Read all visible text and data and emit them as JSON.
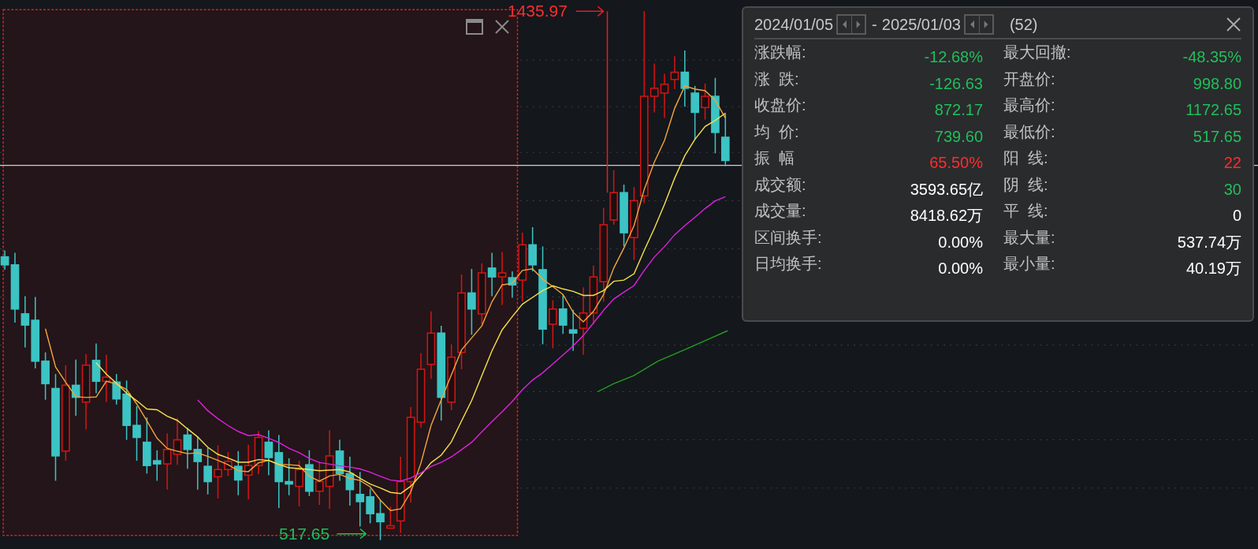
{
  "chart": {
    "high_label": "1435.97",
    "low_label": "517.65"
  },
  "stats_panel": {
    "start_date": "2024/01/05",
    "separator": "-",
    "end_date": "2025/01/03",
    "count": "(52)",
    "left_rows": [
      {
        "label": "涨跌幅:",
        "value": "-12.68%",
        "color": "#1fbf5a"
      },
      {
        "label": "涨  跌:",
        "value": "-126.63",
        "color": "#1fbf5a"
      },
      {
        "label": "收盘价:",
        "value": "872.17",
        "color": "#1fbf5a"
      },
      {
        "label": "均  价:",
        "value": "739.60",
        "color": "#1fbf5a"
      },
      {
        "label": "振  幅",
        "value": "65.50%",
        "color": "#ff2d2d"
      },
      {
        "label": "成交额:",
        "value": "3593.65亿",
        "color": "#ffffff"
      },
      {
        "label": "成交量:",
        "value": "8418.62万",
        "color": "#ffffff"
      },
      {
        "label": "区间换手:",
        "value": "0.00%",
        "color": "#ffffff"
      },
      {
        "label": "日均换手:",
        "value": "0.00%",
        "color": "#ffffff"
      }
    ],
    "right_rows": [
      {
        "label": "最大回撤:",
        "value": "-48.35%",
        "color": "#1fbf5a"
      },
      {
        "label": "开盘价:",
        "value": "998.80",
        "color": "#1fbf5a"
      },
      {
        "label": "最高价:",
        "value": "1172.65",
        "color": "#1fbf5a"
      },
      {
        "label": "最低价:",
        "value": "517.65",
        "color": "#1fbf5a"
      },
      {
        "label": "阳  线:",
        "value": "22",
        "color": "#ff2d2d"
      },
      {
        "label": "阴  线:",
        "value": "30",
        "color": "#1fbf5a"
      },
      {
        "label": "平  线:",
        "value": "0",
        "color": "#ffffff"
      },
      {
        "label": "最大量:",
        "value": "537.74万",
        "color": "#ffffff"
      },
      {
        "label": "最小量:",
        "value": "40.19万",
        "color": "#ffffff"
      }
    ]
  }
}
